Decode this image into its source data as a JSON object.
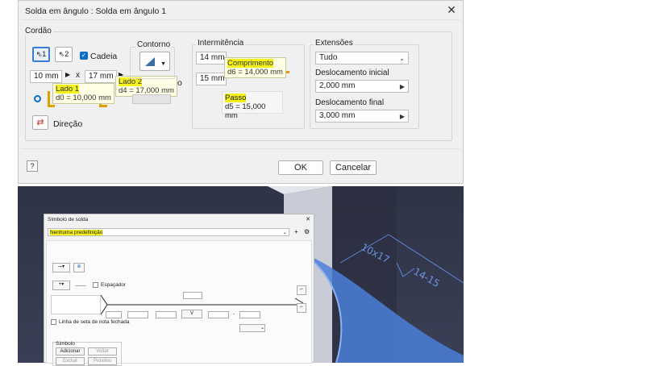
{
  "dialog": {
    "title": "Solda em ângulo : Solda em ângulo 1",
    "close": "✕",
    "ok": "OK",
    "cancel": "Cancelar",
    "help_icon": "help-icon"
  },
  "cordao": {
    "label": "Cordão",
    "sel1": "1",
    "sel2": "2",
    "chain_label": "Cadeia",
    "size1": "10 mm",
    "size_x": "x",
    "size2": "17 mm",
    "direction_label": "Direção",
    "tip_lado1_title": "Lado 1",
    "tip_lado1_val": "d0 = 10,000 mm",
    "tip_lado2_title": "Lado 2",
    "tip_lado2_val": "d4 = 17,000 mm"
  },
  "contorno": {
    "label": "Contorno",
    "hidden_o": "o"
  },
  "intermitencia": {
    "label": "Intermitência",
    "length": "14 mm",
    "pitch": "15 mm",
    "tip_comp_title": "Comprimento",
    "tip_comp_val": "d6 = 14,000 mm",
    "tip_passo_title": "Passo",
    "tip_passo_val": "d5 = 15,000 mm"
  },
  "extensoes": {
    "label": "Extensões",
    "select": "Tudo",
    "start_label": "Deslocamento inicial",
    "start_val": "2,000 mm",
    "end_label": "Deslocamento final",
    "end_val": "3,000 mm"
  },
  "viewport": {
    "annot1": "10x17",
    "annot2": "14-15"
  },
  "symbol_dialog": {
    "title": "Símbolo de solda",
    "close": "✕",
    "preset": "Nenhuma predefinição",
    "spacer_label": "Espaçador",
    "arrow_line_label": "Linha de seta de nota fechada",
    "symbol_group": "Símbolo",
    "add": "Adicionar",
    "back": "Voltar",
    "delete": "Excluir",
    "next": "Próximo",
    "dash": "-"
  }
}
